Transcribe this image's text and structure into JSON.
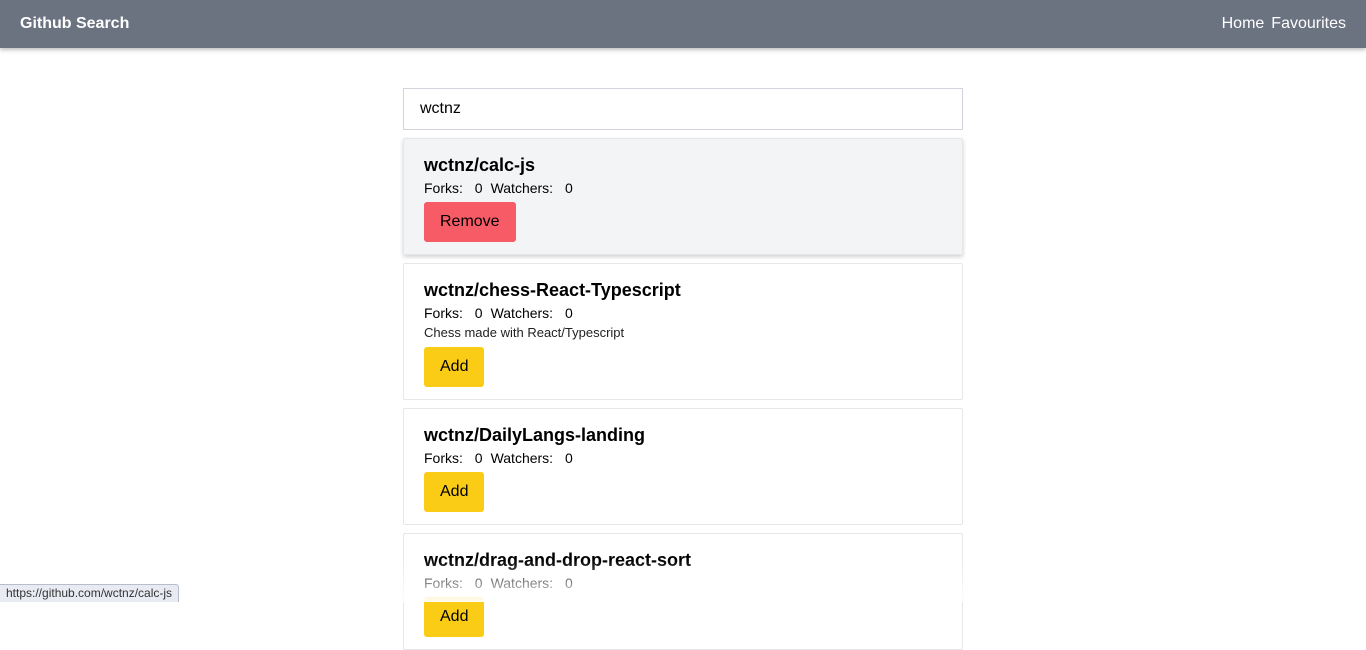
{
  "navbar": {
    "brand": "Github Search",
    "links": [
      "Home",
      "Favourites"
    ]
  },
  "search": {
    "value": "wctnz",
    "placeholder": ""
  },
  "labels": {
    "forks": "Forks:",
    "watchers": "Watchers:"
  },
  "repos": [
    {
      "name": "wctnz/calc-js",
      "forks": "0",
      "watchers": "0",
      "description": "",
      "button": "Remove"
    },
    {
      "name": "wctnz/chess-React-Typescript",
      "forks": "0",
      "watchers": "0",
      "description": "Chess made with React/Typescript",
      "button": "Add"
    },
    {
      "name": "wctnz/DailyLangs-landing",
      "forks": "0",
      "watchers": "0",
      "description": "",
      "button": "Add"
    },
    {
      "name": "wctnz/drag-and-drop-react-sort",
      "forks": "0",
      "watchers": "0",
      "description": "",
      "button": "Add"
    }
  ],
  "statusbar": {
    "url": "https://github.com/wctnz/calc-js"
  },
  "colors": {
    "navbar": "#6b7280",
    "add_button": "#facc15",
    "remove_button": "#f75b66"
  }
}
